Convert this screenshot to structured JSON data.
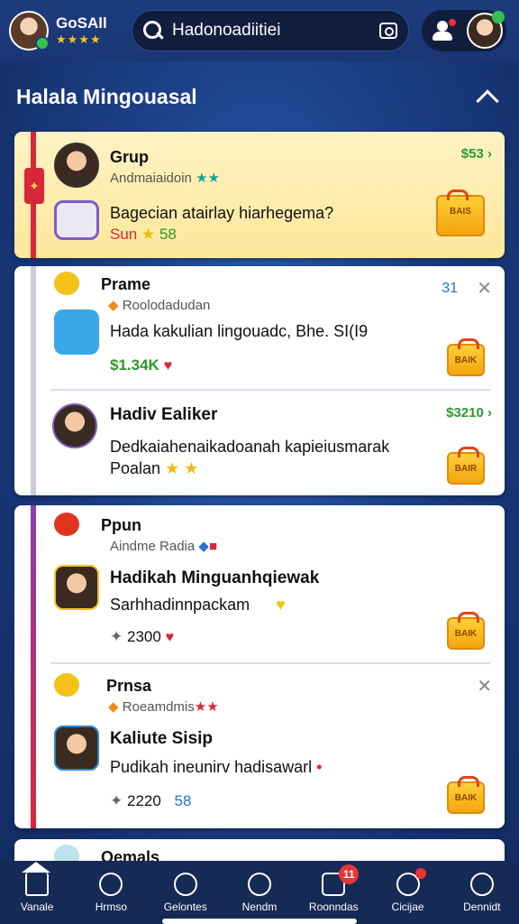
{
  "header": {
    "app_name": "GoSAll",
    "rating_stars": "★★★★",
    "search_value": "Hadonoadiitiei"
  },
  "section": {
    "title": "Halala Mingouasal"
  },
  "cards": [
    {
      "entries": [
        {
          "title": "Grup",
          "subtitle": "Andmaiaidoin",
          "sub_stars": "★★",
          "price": "$53 ›",
          "text": "Bagecian atairlay hiarhegema?",
          "stat_a": "Sun",
          "stat_b": "58",
          "bag_label": "BAIS"
        }
      ]
    },
    {
      "entries": [
        {
          "title": "Prame",
          "subtitle": "Roolodadudan",
          "count": "31",
          "text": "Hada kakulian lingouadc, Bhe. SI(I9",
          "stat": "$1.34K",
          "bag_label": "BAIK"
        },
        {
          "title": "Hadiv Ealiker",
          "price": "$3210 ›",
          "text": "Dedkaiahenaikadoanah kapieiusmarak",
          "text2": "Poalan",
          "bag_label": "BAIR"
        }
      ]
    },
    {
      "entries": [
        {
          "title": "Ppun",
          "subtitle": "Aindme Radia",
          "name": "Hadikah Minguanhqiewak",
          "text": "Sarhhadinnpackam",
          "stat": "2300",
          "bag_label": "BAIK"
        },
        {
          "title": "Prnsa",
          "subtitle": "Roeamdmis",
          "sub_stars": "★★",
          "name": "Kaliute Sisip",
          "text": "Pudikah ineunirv hadisawarl",
          "stat": "2220",
          "stat_b": "58",
          "bag_label": "BAIK"
        }
      ]
    },
    {
      "entries": [
        {
          "title": "Oemals"
        }
      ]
    }
  ],
  "nav": [
    {
      "label": "Vanale",
      "icon": "home-icon"
    },
    {
      "label": "Hrmso",
      "icon": "search-icon"
    },
    {
      "label": "Gelontes",
      "icon": "globe-icon"
    },
    {
      "label": "Nendm",
      "icon": "compass-icon"
    },
    {
      "label": "Roonndas",
      "icon": "edit-icon",
      "badge": "11"
    },
    {
      "label": "Cicijae",
      "icon": "share-icon"
    },
    {
      "label": "Dennidt",
      "icon": "profile-icon"
    }
  ],
  "colors": {
    "background": "#1c3f86",
    "highlight_card": "#fde79a",
    "price_green": "#2a9a2a",
    "stripe_red": "#d8263a",
    "stripe_purple": "#8a3db0"
  }
}
